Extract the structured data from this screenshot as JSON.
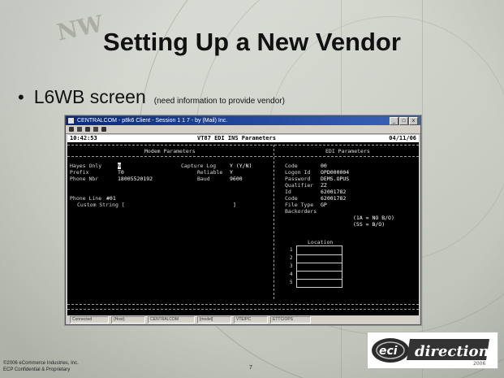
{
  "slide": {
    "title": "Setting Up a New Vendor",
    "bullet": {
      "main": "L6WB screen",
      "note": "(need information to provide vendor)"
    },
    "footer": {
      "copyright": "©2006 eCommerce Industries, Inc.",
      "confidential": "ECP Confidential & Proprietary",
      "page_number": "7"
    }
  },
  "window": {
    "title": "CENTRALCOM - p8k6 Client - Session 1 1 7 - by (Mail) Inc.",
    "controls": [
      "_",
      "□",
      "x"
    ],
    "status_cells": [
      "Connected",
      "(Host)",
      "CENTRALCOM",
      "[model]",
      "VTE/PC",
      "ETTC/OPS"
    ]
  },
  "screen": {
    "time": "10:42:53",
    "heading": "VT87 EDI INS Parameters",
    "date": "04/11/06",
    "modem": {
      "panel_title": "Modem Parameters",
      "labels": {
        "hayes_only": "Hayes Only",
        "prefix": "Prefix",
        "phone_nbr": "Phone Nbr",
        "capture_log": "Capture Log",
        "reliable": "Reliable",
        "baud": "Baud",
        "phone_line": "Phone Line",
        "custom_string": "Custom String ["
      },
      "values": {
        "hayes_only": "N",
        "prefix": "T0",
        "phone_nbr": "18005520192",
        "capture_log": "Y (Y/N)",
        "reliable": "Y",
        "baud": "9600",
        "phone_line": "#01",
        "custom_string_end": "]"
      }
    },
    "edi": {
      "panel_title": "EDI Parameters",
      "labels": {
        "code": "Code",
        "logon_id": "Logon Id",
        "password": "Password",
        "qualifier": "Qualifier",
        "id": "Id",
        "code2": "Code",
        "file_type": "File Type",
        "backorders": "Backorders"
      },
      "values": {
        "code": "00",
        "logon_id": "OPD000004",
        "password": "DEMS.OPUS",
        "qualifier": "ZZ",
        "id": "62001782",
        "code2": "62001782",
        "file_type": "GP",
        "backorders": "(1A = NO B/O)",
        "backorders_2": "(5S = B/O)"
      },
      "location_title": "Location",
      "location_rows": [
        "1",
        "2",
        "3",
        "4",
        "5"
      ]
    }
  }
}
